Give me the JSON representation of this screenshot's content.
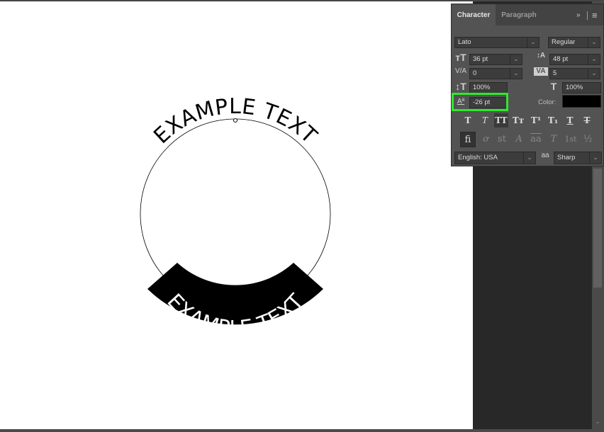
{
  "artwork": {
    "top_text": "EXAMPLE TEXT",
    "bottom_text": "EXAMPLE TEXT",
    "colors": {
      "canvas": "#ffffff",
      "text": "#000000",
      "banner": "#000000",
      "banner_text": "#ffffff"
    }
  },
  "panel": {
    "tabs": [
      {
        "label": "Character",
        "active": true
      },
      {
        "label": "Paragraph",
        "active": false
      }
    ],
    "expand_icon": "»",
    "menu_icon": "≡",
    "font_family": "Lato",
    "font_style": "Regular",
    "font_size": "36 pt",
    "leading": "48 pt",
    "kerning": "0",
    "tracking": "5",
    "vertical_scale": "100%",
    "horizontal_scale": "100%",
    "baseline_shift": "-26 pt",
    "color_label": "Color:",
    "color_value": "#000000",
    "highlight_color": "#2ee82a",
    "type_styles": [
      {
        "name": "faux-bold",
        "glyph": "T",
        "active": false
      },
      {
        "name": "faux-italic",
        "glyph": "T",
        "active": false
      },
      {
        "name": "all-caps",
        "glyph": "TT",
        "active": true
      },
      {
        "name": "small-caps",
        "glyph": "Tт",
        "active": false
      },
      {
        "name": "superscript",
        "glyph": "T¹",
        "active": false
      },
      {
        "name": "subscript",
        "glyph": "T₁",
        "active": false
      },
      {
        "name": "underline",
        "glyph": "T",
        "active": false
      },
      {
        "name": "strikethrough",
        "glyph": "T",
        "active": false
      }
    ],
    "opentype_features": [
      {
        "name": "standard-ligatures",
        "glyph": "fi",
        "active": true
      },
      {
        "name": "contextual-alternates",
        "glyph": "ơ",
        "active": false
      },
      {
        "name": "discretionary-ligatures",
        "glyph": "st",
        "active": false
      },
      {
        "name": "swash",
        "glyph": "A",
        "active": false
      },
      {
        "name": "stylistic-alternates",
        "glyph": "aa",
        "active": false
      },
      {
        "name": "titling-alternates",
        "glyph": "T",
        "active": false
      },
      {
        "name": "ordinals",
        "glyph": "1st",
        "active": false
      },
      {
        "name": "fractions",
        "glyph": "½",
        "active": false
      }
    ],
    "language": "English: USA",
    "antialias_icon": "aa",
    "antialias": "Sharp"
  }
}
